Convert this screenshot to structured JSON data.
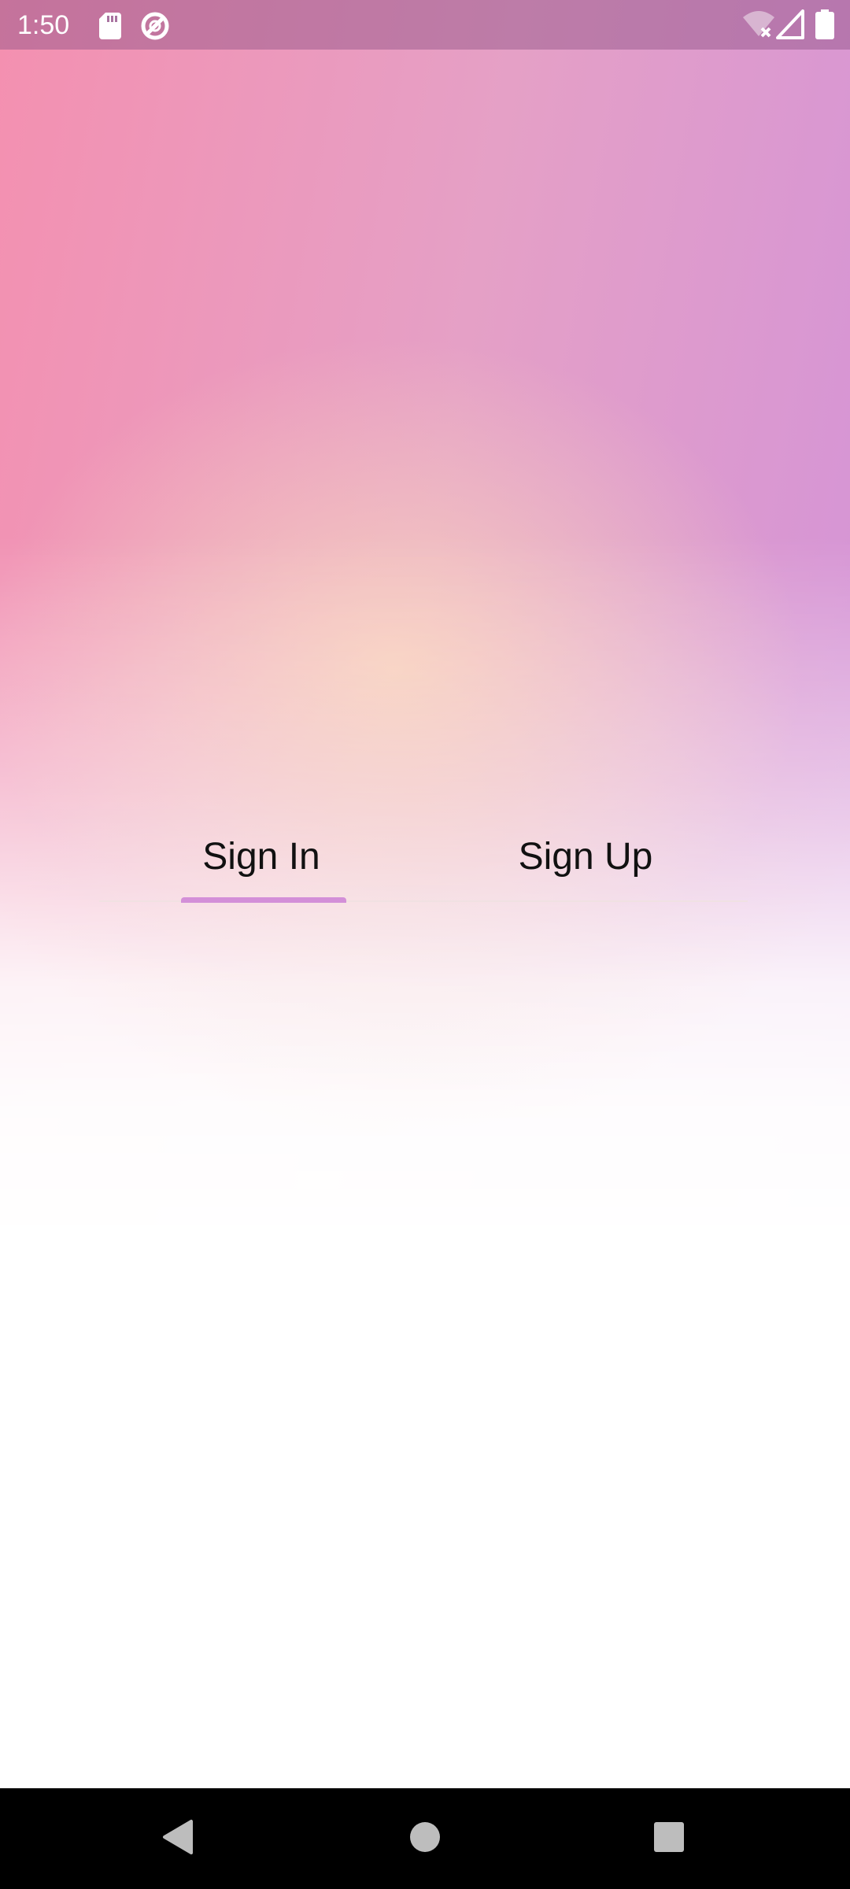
{
  "status_bar": {
    "time": "1:50",
    "left_icons": [
      "sd-card-icon",
      "data-saver-icon"
    ],
    "right_icons": [
      "wifi-off-icon",
      "cellular-signal-icon",
      "battery-icon"
    ]
  },
  "tabs": [
    {
      "label": "Sign In",
      "selected": true
    },
    {
      "label": "Sign Up",
      "selected": false
    }
  ],
  "colors": {
    "gradient_pink": "#f490b0",
    "gradient_purple": "#cf90dc",
    "gradient_peach": "#fad7be",
    "tab_indicator": "#d38fd8",
    "tab_text": "#111111",
    "nav_bar": "#000000"
  },
  "nav_bar": {
    "buttons": [
      "back-icon",
      "home-icon",
      "recents-icon"
    ]
  }
}
